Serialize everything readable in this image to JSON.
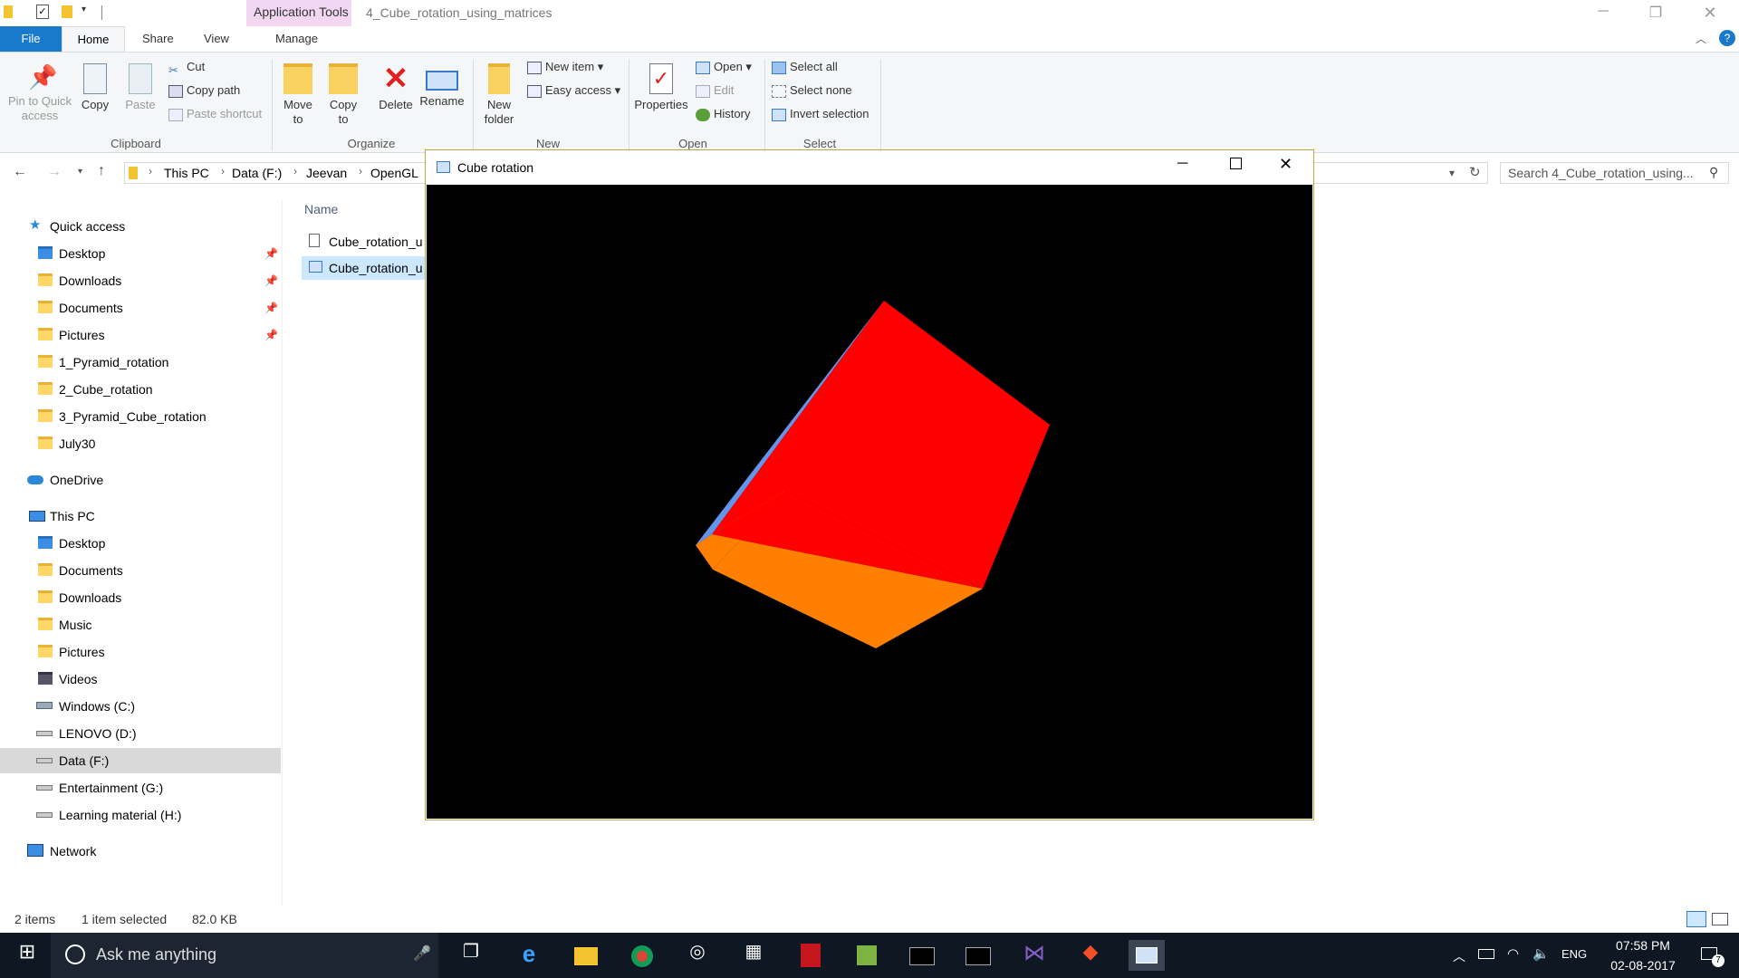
{
  "explorer": {
    "context_tab": "Application Tools",
    "window_title": "4_Cube_rotation_using_matrices",
    "tabs": {
      "file": "File",
      "home": "Home",
      "share": "Share",
      "view": "View",
      "manage": "Manage"
    },
    "ribbon": {
      "clipboard": {
        "group": "Clipboard",
        "pin": "Pin to Quick access",
        "copy": "Copy",
        "paste": "Paste",
        "cut": "Cut",
        "copy_path": "Copy path",
        "paste_shortcut": "Paste shortcut"
      },
      "organize": {
        "group": "Organize",
        "move_to": "Move to",
        "copy_to": "Copy to",
        "delete": "Delete",
        "rename": "Rename"
      },
      "new": {
        "group": "New",
        "new_folder": "New folder",
        "new_item": "New item",
        "easy_access": "Easy access"
      },
      "open": {
        "group": "Open",
        "properties": "Properties",
        "open": "Open",
        "edit": "Edit",
        "history": "History"
      },
      "select": {
        "group": "Select",
        "select_all": "Select all",
        "select_none": "Select none",
        "invert": "Invert selection"
      }
    },
    "breadcrumb": [
      "This PC",
      "Data (F:)",
      "Jeevan",
      "OpenGL"
    ],
    "search_placeholder": "Search 4_Cube_rotation_using...",
    "column_header": "Name",
    "files": [
      "Cube_rotation_u",
      "Cube_rotation_u"
    ],
    "nav": {
      "quick_access": "Quick access",
      "quick_items": [
        "Desktop",
        "Downloads",
        "Documents",
        "Pictures",
        "1_Pyramid_rotation",
        "2_Cube_rotation",
        "3_Pyramid_Cube_rotation",
        "July30"
      ],
      "onedrive": "OneDrive",
      "this_pc": "This PC",
      "pc_items": [
        "Desktop",
        "Documents",
        "Downloads",
        "Music",
        "Pictures",
        "Videos",
        "Windows (C:)",
        "LENOVO (D:)",
        "Data (F:)",
        "Entertainment (G:)",
        "Learning material (H:)"
      ],
      "network": "Network"
    },
    "status": {
      "items": "2 items",
      "selected": "1 item selected",
      "size": "82.0 KB"
    }
  },
  "cube_window": {
    "title": "Cube rotation",
    "colors": {
      "top": "#ff0000",
      "front": "#ff7f00",
      "side": "#6495ed",
      "background": "#000000"
    }
  },
  "taskbar": {
    "search": "Ask me anything",
    "lang": "ENG",
    "time": "07:58 PM",
    "date": "02-08-2017",
    "notifications": "7"
  }
}
